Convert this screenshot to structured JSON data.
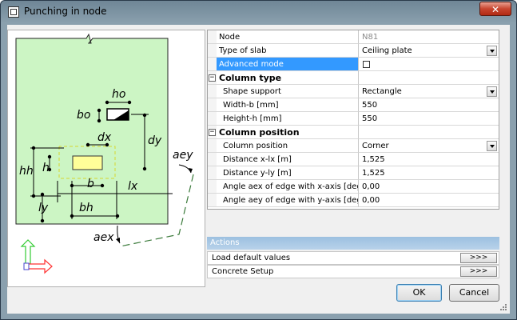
{
  "window": {
    "title": "Punching in node",
    "close_label": "✕"
  },
  "diagram": {
    "labels": {
      "ho": "ho",
      "bo": "bo",
      "dx": "dx",
      "dy": "dy",
      "hh": "hh",
      "h": "h",
      "b": "b",
      "bh": "bh",
      "lx": "lx",
      "ly": "ly",
      "aey": "aey",
      "aex": "aex"
    },
    "colors": {
      "slab": "#ccf5c4",
      "column": "#ffff99",
      "axis_y": "#33cc33",
      "axis_x": "#ff3333"
    }
  },
  "properties": {
    "rows": [
      {
        "label": "Node",
        "value": "N81"
      },
      {
        "label": "Type of slab",
        "value": "Ceiling plate"
      },
      {
        "label": "Advanced mode",
        "value": ""
      },
      {
        "label": "Column type",
        "value": ""
      },
      {
        "label": "Shape support",
        "value": "Rectangle"
      },
      {
        "label": "Width-b [mm]",
        "value": "550"
      },
      {
        "label": "Height-h [mm]",
        "value": "550"
      },
      {
        "label": "Column position",
        "value": ""
      },
      {
        "label": "Column position",
        "value": "Corner"
      },
      {
        "label": "Distance x-lx [m]",
        "value": "1,525"
      },
      {
        "label": "Distance y-ly [m]",
        "value": "1,525"
      },
      {
        "label": "Angle aex of edge with x-axis [deg]",
        "value": "0,00"
      },
      {
        "label": "Angle aey of edge with y-axis [deg]",
        "value": "0,00"
      }
    ],
    "collapse_symbol": "−"
  },
  "actions": {
    "header": "Actions",
    "items": [
      {
        "label": "Load default values",
        "button": ">>>"
      },
      {
        "label": "Concrete Setup",
        "button": ">>>"
      }
    ]
  },
  "buttons": {
    "ok": "OK",
    "cancel": "Cancel"
  }
}
